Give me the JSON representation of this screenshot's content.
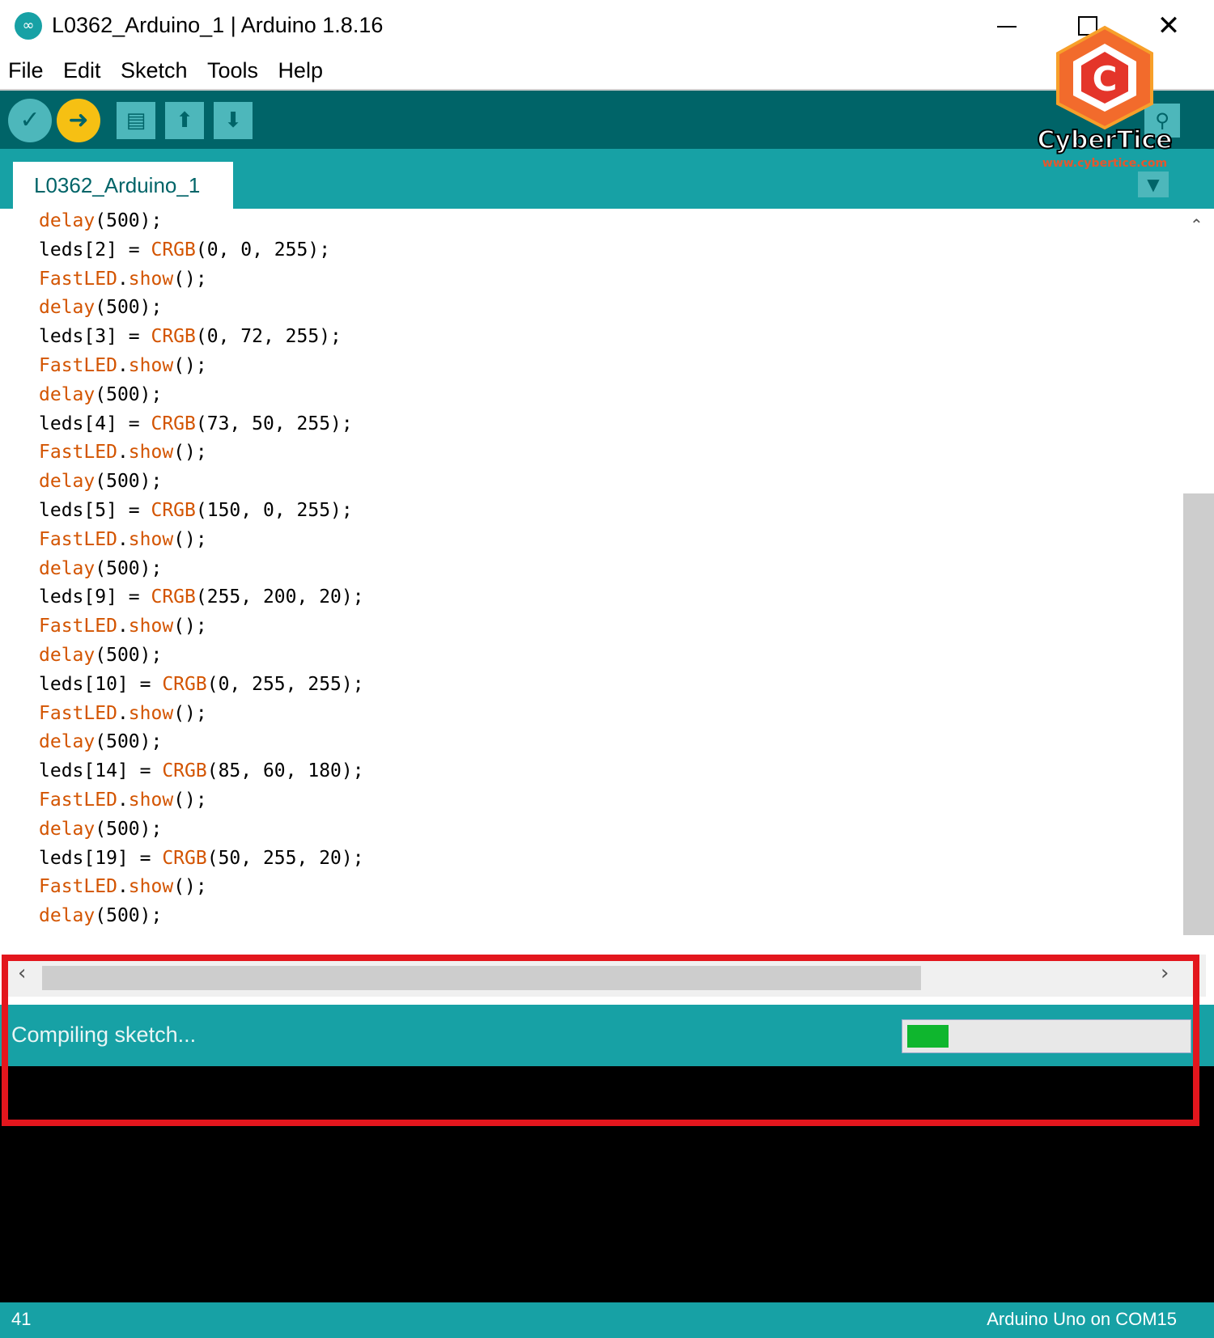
{
  "window": {
    "title": "L0362_Arduino_1 | Arduino 1.8.16",
    "close_glyph": "✕"
  },
  "menu": {
    "items": [
      "File",
      "Edit",
      "Sketch",
      "Tools",
      "Help"
    ]
  },
  "toolbar": {
    "verify_glyph": "✓",
    "upload_glyph": "➜",
    "new_glyph": "▤",
    "open_glyph": "⬆",
    "save_glyph": "⬇",
    "serial_glyph": "⚲"
  },
  "tab": {
    "label": "L0362_Arduino_1",
    "menu_glyph": "▼"
  },
  "code": {
    "lines": [
      "delay(500);",
      "leds[2] = CRGB(0, 0, 255);",
      "FastLED.show();",
      "delay(500);",
      "leds[3] = CRGB(0, 72, 255);",
      "FastLED.show();",
      "delay(500);",
      "leds[4] = CRGB(73, 50, 255);",
      "FastLED.show();",
      "delay(500);",
      "leds[5] = CRGB(150, 0, 255);",
      "FastLED.show();",
      "delay(500);",
      "leds[9] = CRGB(255, 200, 20);",
      "FastLED.show();",
      "delay(500);",
      "leds[10] = CRGB(0, 255, 255);",
      "FastLED.show();",
      "delay(500);",
      "leds[14] = CRGB(85, 60, 180);",
      "FastLED.show();",
      "delay(500);",
      "leds[19] = CRGB(50, 255, 20);",
      "FastLED.show();",
      "delay(500);"
    ]
  },
  "status": {
    "message": "Compiling sketch...",
    "progress": 0.15
  },
  "bottom": {
    "line_number": "41",
    "board_info": "Arduino Uno on COM15"
  },
  "watermark": {
    "brand": "CyberTice",
    "url": "www.cybertice.com"
  },
  "colors": {
    "teal": "#17a1a5",
    "dark_teal": "#006468",
    "keyword": "#d35400",
    "progress_fill": "#0fb62e",
    "highlight": "#e3161d"
  }
}
